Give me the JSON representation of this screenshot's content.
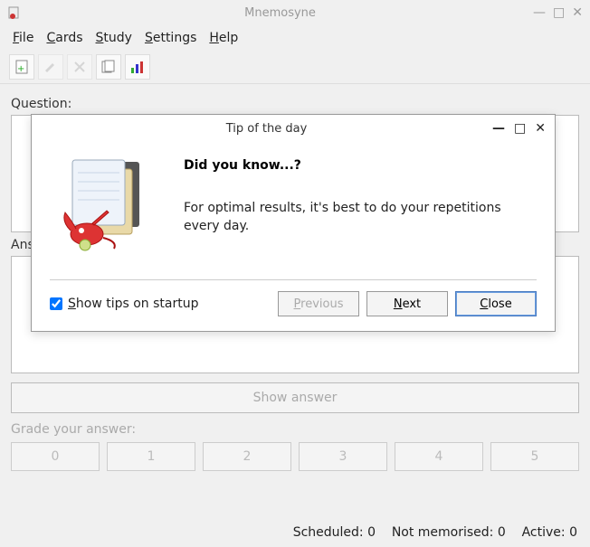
{
  "app": {
    "title": "Mnemosyne"
  },
  "menu": {
    "file": "File",
    "cards": "Cards",
    "study": "Study",
    "settings": "Settings",
    "help": "Help"
  },
  "toolbar_icons": [
    "add-card-icon",
    "edit-icon",
    "delete-icon",
    "browse-icon",
    "stats-icon"
  ],
  "labels": {
    "question": "Question:",
    "answer": "Answer:",
    "show_answer": "Show answer",
    "grade": "Grade your answer:"
  },
  "grades": [
    "0",
    "1",
    "2",
    "3",
    "4",
    "5"
  ],
  "status": {
    "scheduled_label": "Scheduled:",
    "scheduled": 0,
    "not_memorised_label": "Not memorised:",
    "not_memorised": 0,
    "active_label": "Active:",
    "active": 0
  },
  "dialog": {
    "title": "Tip of the day",
    "heading": "Did you know...?",
    "tip": "For optimal results, it's best to do your repetitions every day.",
    "show_tips_label": "Show tips on startup",
    "show_tips_checked": true,
    "previous": "Previous",
    "next": "Next",
    "close": "Close"
  }
}
